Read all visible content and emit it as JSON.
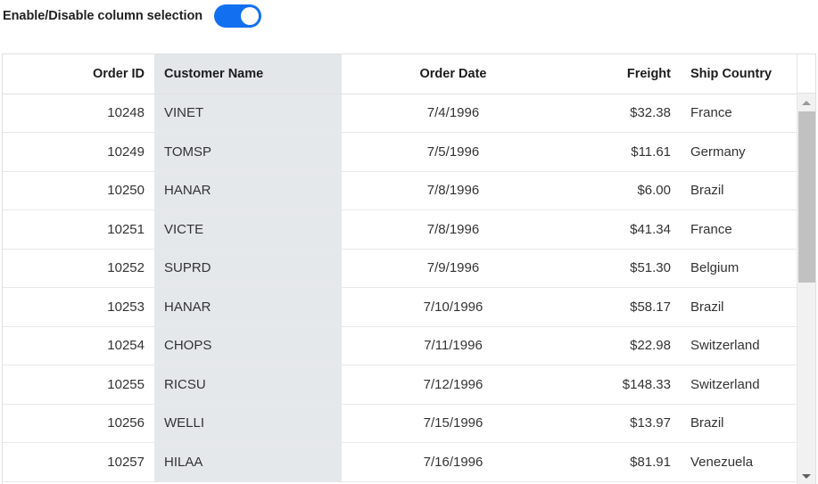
{
  "toggle": {
    "label": "Enable/Disable column selection",
    "state": "on",
    "accent_color": "#1270f0",
    "knob_color": "#ffffff"
  },
  "grid": {
    "selected_column": "Customer Name",
    "selected_color": "#e4e8eb",
    "columns": [
      {
        "key": "order_id",
        "label": "Order ID",
        "align": "right",
        "selected": false
      },
      {
        "key": "customer",
        "label": "Customer Name",
        "align": "left",
        "selected": true
      },
      {
        "key": "order_date",
        "label": "Order Date",
        "align": "center",
        "selected": false
      },
      {
        "key": "freight",
        "label": "Freight",
        "align": "right",
        "selected": false
      },
      {
        "key": "ship_country",
        "label": "Ship Country",
        "align": "left",
        "selected": false
      }
    ],
    "rows": [
      {
        "order_id": "10248",
        "customer": "VINET",
        "order_date": "7/4/1996",
        "freight": "$32.38",
        "ship_country": "France"
      },
      {
        "order_id": "10249",
        "customer": "TOMSP",
        "order_date": "7/5/1996",
        "freight": "$11.61",
        "ship_country": "Germany"
      },
      {
        "order_id": "10250",
        "customer": "HANAR",
        "order_date": "7/8/1996",
        "freight": "$6.00",
        "ship_country": "Brazil"
      },
      {
        "order_id": "10251",
        "customer": "VICTE",
        "order_date": "7/8/1996",
        "freight": "$41.34",
        "ship_country": "France"
      },
      {
        "order_id": "10252",
        "customer": "SUPRD",
        "order_date": "7/9/1996",
        "freight": "$51.30",
        "ship_country": "Belgium"
      },
      {
        "order_id": "10253",
        "customer": "HANAR",
        "order_date": "7/10/1996",
        "freight": "$58.17",
        "ship_country": "Brazil"
      },
      {
        "order_id": "10254",
        "customer": "CHOPS",
        "order_date": "7/11/1996",
        "freight": "$22.98",
        "ship_country": "Switzerland"
      },
      {
        "order_id": "10255",
        "customer": "RICSU",
        "order_date": "7/12/1996",
        "freight": "$148.33",
        "ship_country": "Switzerland"
      },
      {
        "order_id": "10256",
        "customer": "WELLI",
        "order_date": "7/15/1996",
        "freight": "$13.97",
        "ship_country": "Brazil"
      },
      {
        "order_id": "10257",
        "customer": "HILAA",
        "order_date": "7/16/1996",
        "freight": "$81.91",
        "ship_country": "Venezuela"
      }
    ]
  },
  "scrollbar": {
    "up_icon": "caret-up-icon",
    "down_icon": "caret-down-icon",
    "thumb_color": "#c1c1c1",
    "track_color": "#f1f1f1"
  }
}
